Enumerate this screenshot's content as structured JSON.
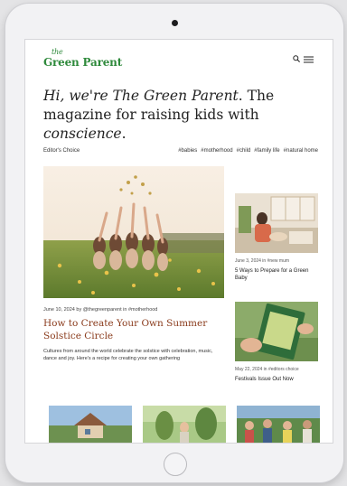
{
  "site": {
    "logo_prefix": "the",
    "logo_name": "Green Parent"
  },
  "header": {
    "search_icon": "search-icon",
    "menu_icon": "menu-icon"
  },
  "hero": {
    "part1": "Hi, we're ",
    "brand": "The Green Parent",
    "part2": ". The magazine for raising kids with ",
    "emphasis": "conscience",
    "part3": "."
  },
  "filters": {
    "label": "Editor's Choice",
    "tags": [
      "#babies",
      "#motherhood",
      "#child",
      "#family life",
      "#natural home"
    ]
  },
  "feature": {
    "meta": "June 10, 2024 by @thegreenparent in #motherhood",
    "title": "How to Create Your Own Summer Solstice Circle",
    "excerpt": "Cultures from around the world celebrate the solstice with celebration, music, dance and joy. Here's a recipe for creating your own gathering"
  },
  "side_articles": [
    {
      "meta": "June 3, 2024 in #new mum",
      "title": "5 Ways to Prepare for a Green Baby"
    },
    {
      "meta": "May 22, 2024 in #editors choice",
      "title": "Festivals Issue Out Now"
    }
  ],
  "colors": {
    "brand_green": "#2f8a3c",
    "title_rust": "#8a3b1c"
  }
}
